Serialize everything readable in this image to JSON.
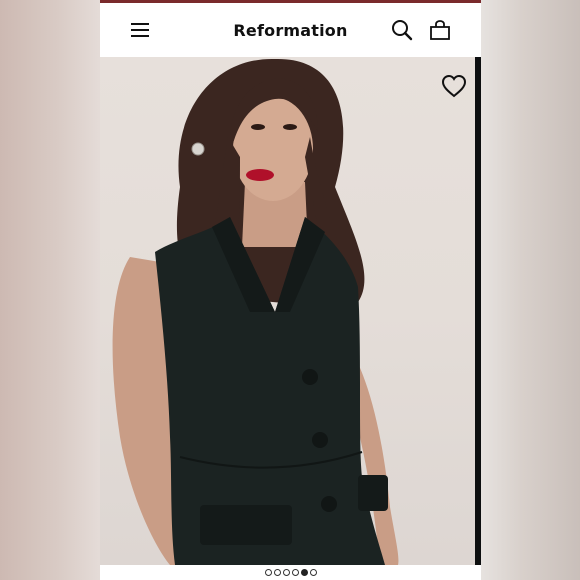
{
  "header": {
    "brand": "Reformation",
    "menu_icon": "hamburger-menu-icon",
    "search_icon": "search-icon",
    "bag_icon": "shopping-bag-icon"
  },
  "product": {
    "image": "model-in-black-sleeveless-blazer-dress",
    "favorite_icon": "heart-icon"
  },
  "carousel": {
    "total": 6,
    "active_index": 4
  },
  "colors": {
    "accent": "#7a2a2c",
    "text": "#111111",
    "dress": "#1b2322"
  }
}
